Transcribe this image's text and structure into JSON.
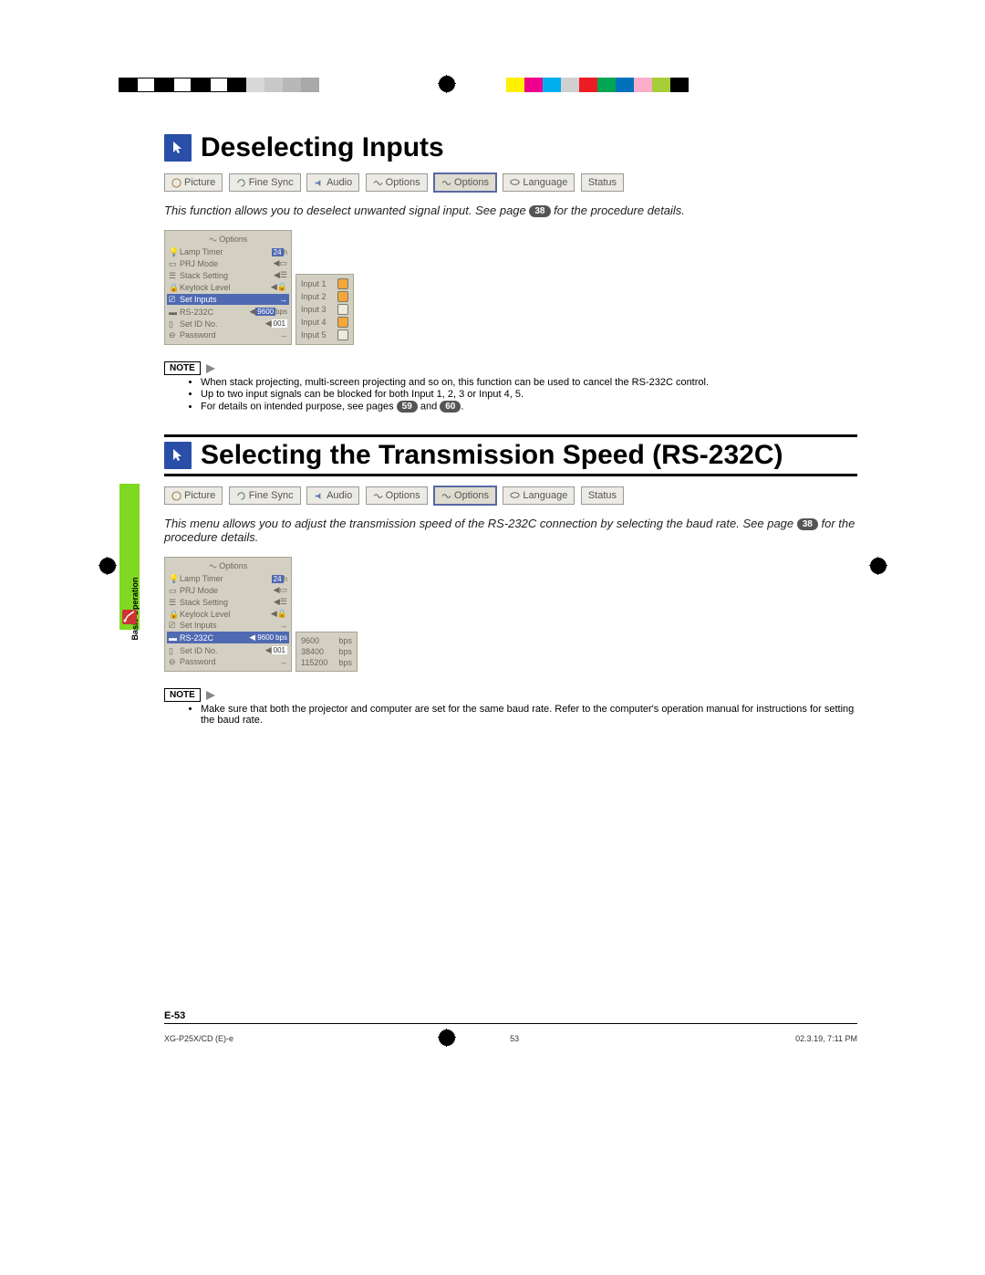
{
  "colorbar_left": [
    "#000",
    "#fff",
    "#000",
    "#fff",
    "#000",
    "#fff",
    "#000",
    "#d0d0d0",
    "#b8b8b8",
    "#a0a0a0",
    "#888",
    "#fff"
  ],
  "colorbar_right": [
    "#fff100",
    "#ec008c",
    "#00aeef",
    "#d0d0d0",
    "#ed1c24",
    "#00a651",
    "#0072bc",
    "#faaecb",
    "#a6ce39",
    "#000"
  ],
  "side_tab_label": "Basic Operation",
  "section1": {
    "title": "Deselecting Inputs",
    "intro_before": "This function allows you to deselect unwanted signal input. See page ",
    "intro_pill": "38",
    "intro_after": " for the procedure details.",
    "note_label": "NOTE",
    "notes": [
      "When stack projecting, multi-screen projecting and so on, this function can be used to cancel the RS-232C control.",
      "Up to two input signals can be blocked for both Input 1, 2, 3 or Input 4, 5."
    ],
    "note3_before": "For details on intended purpose, see pages ",
    "note3_pill1": "59",
    "note3_mid": " and ",
    "note3_pill2": "60",
    "note3_after": "."
  },
  "section2": {
    "title": "Selecting the Transmission Speed (RS-232C)",
    "intro_before": "This menu allows you to adjust the transmission speed of the RS-232C connection by selecting the baud rate. See page ",
    "intro_pill": "38",
    "intro_after": " for the procedure details.",
    "note_label": "NOTE",
    "notes": [
      "Make sure that both the projector and computer are set for the same baud rate. Refer to the computer's operation manual for instructions for setting the baud rate."
    ]
  },
  "tabs": [
    {
      "label": "Picture",
      "icon": "picture"
    },
    {
      "label": "Fine Sync",
      "icon": "sync"
    },
    {
      "label": "Audio",
      "icon": "audio"
    },
    {
      "label": "Options",
      "icon": "options"
    },
    {
      "label": "Options",
      "icon": "options",
      "selected": true
    },
    {
      "label": "Language",
      "icon": "language"
    },
    {
      "label": "Status",
      "icon": ""
    }
  ],
  "osd": {
    "title": "Options",
    "rows": [
      {
        "icon": "lamp",
        "label": "Lamp Timer",
        "valbox": "24",
        "suffix": "h"
      },
      {
        "icon": "prj",
        "label": "PRJ Mode",
        "end": "screen"
      },
      {
        "icon": "stack",
        "label": "Stack Setting",
        "end": "stack"
      },
      {
        "icon": "lock",
        "label": "Keylock Level",
        "end": "lock"
      },
      {
        "icon": "input",
        "label": "Set Inputs",
        "end": "arrow",
        "hl1": true
      },
      {
        "icon": "rs",
        "label": "RS-232C",
        "valbox": "9600",
        "suffix": "bps",
        "hl2": true
      },
      {
        "icon": "id",
        "label": "Set ID No.",
        "valboxw": "001"
      },
      {
        "icon": "pwd",
        "label": "Password",
        "end": "arrow"
      }
    ]
  },
  "sub_panel_inputs": [
    {
      "label": "Input 1",
      "on": true
    },
    {
      "label": "Input 2",
      "on": true
    },
    {
      "label": "Input 3",
      "on": false
    },
    {
      "label": "Input 4",
      "on": true
    },
    {
      "label": "Input 5",
      "on": false
    }
  ],
  "sub_panel_baud": [
    {
      "label": "9600",
      "suffix": "bps"
    },
    {
      "label": "38400",
      "suffix": "bps"
    },
    {
      "label": "115200",
      "suffix": "bps"
    }
  ],
  "page_number": "E-53",
  "footer_model": "XG-P25X/CD (E)-e",
  "footer_page": "53",
  "footer_date": "02.3.19, 7:11 PM"
}
